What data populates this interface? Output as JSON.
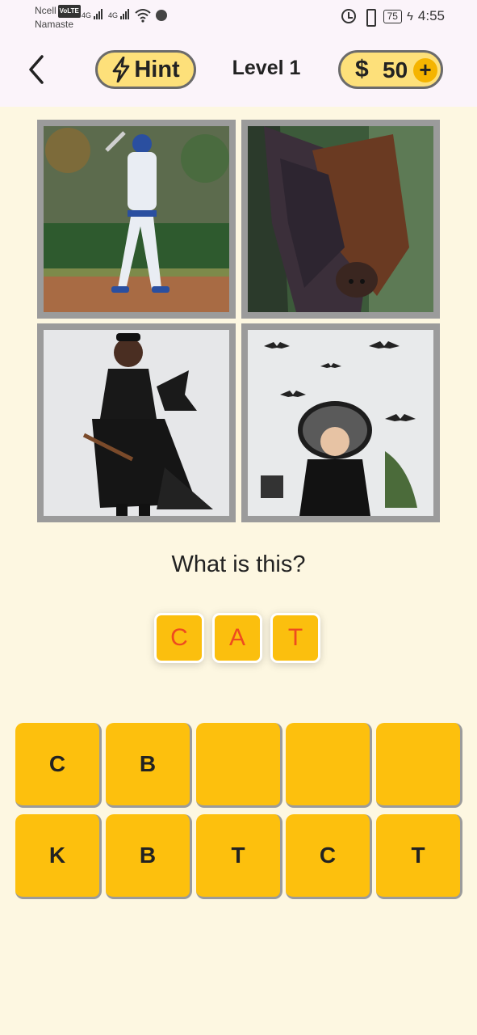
{
  "status_bar": {
    "carrier": "Ncell",
    "volte": "VoLTE",
    "sub_carrier": "Namaste",
    "network_1": "4G",
    "network_2": "4G",
    "battery": "75",
    "time": "4:55",
    "icons": [
      "signal-icon",
      "wifi-icon",
      "messenger-icon",
      "alarm-icon",
      "vibrate-icon",
      "battery-icon",
      "charging-icon"
    ]
  },
  "header": {
    "back_icon": "chevron-left-icon",
    "hint_label": "Hint",
    "hint_icon": "lightning-icon",
    "level_label": "Level 1",
    "coin_symbol": "$",
    "coins": "50",
    "plus_label": "+"
  },
  "images": [
    {
      "name": "baseball-batter-image"
    },
    {
      "name": "hanging-fruit-bat-image"
    },
    {
      "name": "girl-in-bat-costume-image"
    },
    {
      "name": "child-witch-hat-with-paper-bats-image"
    }
  ],
  "question": "What is this?",
  "answer_slots": [
    "C",
    "A",
    "T"
  ],
  "keyboard": {
    "row1": [
      "C",
      "B",
      "",
      "",
      ""
    ],
    "row2": [
      "K",
      "B",
      "T",
      "C",
      "T"
    ]
  },
  "colors": {
    "background": "#fdf7e1",
    "header_background": "#fbf4fa",
    "key": "#fdc00d",
    "pill": "#fde07a",
    "answer_letter": "#ee4b1f",
    "tile_border": "#9b9b9b"
  }
}
